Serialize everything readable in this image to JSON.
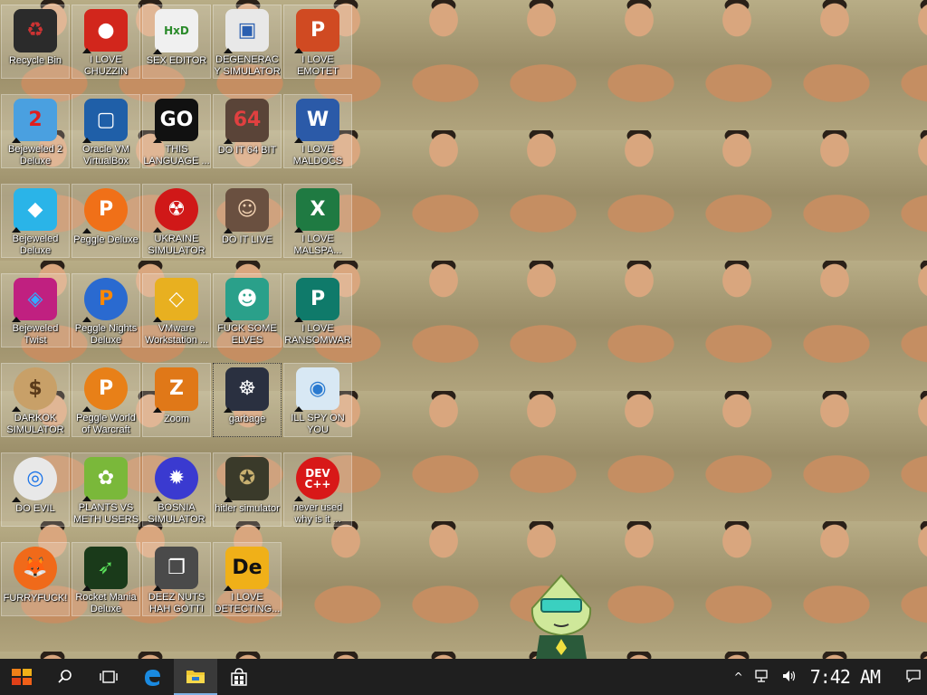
{
  "desktop": {
    "icons": [
      {
        "label": "Recycle Bin",
        "icon": "recycle-bin-icon",
        "bg": "#2b2b2b",
        "fg": "#c33",
        "ch": "♻",
        "shortcut": false
      },
      {
        "label": "I LOVE CHUZZIN",
        "icon": "chuzzle-icon",
        "bg": "#d2261c",
        "fg": "#fff",
        "ch": "●",
        "shortcut": true
      },
      {
        "label": "SEX EDITOR",
        "icon": "hxd-editor-icon",
        "bg": "#f0f0f0",
        "fg": "#2a8a2a",
        "ch": "HxD",
        "shortcut": true
      },
      {
        "label": "DEGENERACY SIMULATOR",
        "icon": "windows-sandbox-icon",
        "bg": "#e8e8e8",
        "fg": "#2a5fb0",
        "ch": "▣",
        "shortcut": true
      },
      {
        "label": "I LOVE EMOTET",
        "icon": "powerpoint-icon",
        "bg": "#d04a22",
        "fg": "#fff",
        "ch": "P",
        "shortcut": true
      },
      {
        "label": "Bejeweled 2 Deluxe",
        "icon": "bejeweled-2-icon",
        "bg": "#4aa0e0",
        "fg": "#e01e1e",
        "ch": "2",
        "shortcut": true
      },
      {
        "label": "Oracle VM VirtualBox",
        "icon": "virtualbox-icon",
        "bg": "#1f5fa8",
        "fg": "#fff",
        "ch": "▢",
        "shortcut": true
      },
      {
        "label": "THIS LANGUAGE ...",
        "icon": "goland-icon",
        "bg": "#111",
        "fg": "#fff",
        "ch": "GO",
        "shortcut": true
      },
      {
        "label": "DO IT 64 BIT",
        "icon": "portrait-64-icon",
        "bg": "#5a4438",
        "fg": "#e04040",
        "ch": "64",
        "shortcut": true
      },
      {
        "label": "I LOVE MALDOCS",
        "icon": "word-icon",
        "bg": "#2b5aa8",
        "fg": "#fff",
        "ch": "W",
        "shortcut": true
      },
      {
        "label": "Bejeweled Deluxe",
        "icon": "bejeweled-diamond-icon",
        "bg": "#2ab4e8",
        "fg": "#fff",
        "ch": "◆",
        "shortcut": true
      },
      {
        "label": "Peggle Deluxe",
        "icon": "peggle-icon",
        "bg": "#f07018",
        "fg": "#fff",
        "ch": "P",
        "shortcut": true
      },
      {
        "label": "UKRAINE SIMULATOR",
        "icon": "radiation-icon",
        "bg": "#d01818",
        "fg": "#fff",
        "ch": "☢",
        "shortcut": true
      },
      {
        "label": "DO IT LIVE",
        "icon": "portrait-icon",
        "bg": "#6a5040",
        "fg": "#f0d0b0",
        "ch": "☺",
        "shortcut": true
      },
      {
        "label": "I LOVE MALSPA...",
        "icon": "excel-icon",
        "bg": "#1f7a42",
        "fg": "#fff",
        "ch": "X",
        "shortcut": true
      },
      {
        "label": "Bejeweled Twist",
        "icon": "bejeweled-twist-icon",
        "bg": "#c02080",
        "fg": "#3af",
        "ch": "◈",
        "shortcut": true
      },
      {
        "label": "Peggle Nights Deluxe",
        "icon": "peggle-nights-icon",
        "bg": "#2a6ad0",
        "fg": "#f80",
        "ch": "P",
        "shortcut": true
      },
      {
        "label": "VMware Workstation ...",
        "icon": "vmware-icon",
        "bg": "#e8b020",
        "fg": "#fff",
        "ch": "◇",
        "shortcut": true
      },
      {
        "label": "FUCK SOME ELVES",
        "icon": "elf-icon",
        "bg": "#2aa08a",
        "fg": "#fff",
        "ch": "☻",
        "shortcut": true
      },
      {
        "label": "I LOVE RANSOMWARE",
        "icon": "publisher-icon",
        "bg": "#0f7a6a",
        "fg": "#fff",
        "ch": "P",
        "shortcut": true
      },
      {
        "label": "DARKOK SIMULATOR",
        "icon": "money-bag-icon",
        "bg": "#c8a068",
        "fg": "#5a3a1a",
        "ch": "$",
        "shortcut": true
      },
      {
        "label": "Peggle World of Warcraft Edition",
        "icon": "peggle-wow-icon",
        "bg": "#e88018",
        "fg": "#fff",
        "ch": "P",
        "shortcut": true
      },
      {
        "label": "Zoom",
        "icon": "zuma-icon",
        "bg": "#e07818",
        "fg": "#fff",
        "ch": "Z",
        "shortcut": true
      },
      {
        "label": "garbage",
        "icon": "elephant-emblem-icon",
        "bg": "#2a3040",
        "fg": "#fff",
        "ch": "☸",
        "shortcut": true,
        "selected": true
      },
      {
        "label": "ILL SPY ON YOU",
        "icon": "spy-camera-icon",
        "bg": "#d8e8f4",
        "fg": "#2a7ad0",
        "ch": "◉",
        "shortcut": true
      },
      {
        "label": "DO EVIL",
        "icon": "chrome-icon",
        "bg": "#e8e8e8",
        "fg": "#1a73e8",
        "ch": "◎",
        "shortcut": true
      },
      {
        "label": "PLANTS VS METH USERS",
        "icon": "plants-vs-zombies-icon",
        "bg": "#7ab83a",
        "fg": "#fff",
        "ch": "✿",
        "shortcut": true
      },
      {
        "label": "BOSNIA SIMULATOR",
        "icon": "virus-icon",
        "bg": "#3a3ad0",
        "fg": "#fff",
        "ch": "✹",
        "shortcut": true
      },
      {
        "label": "hitler simulator",
        "icon": "coin-emblem-icon",
        "bg": "#3a3a2a",
        "fg": "#c8b070",
        "ch": "✪",
        "shortcut": true
      },
      {
        "label": "never used why is it ...",
        "icon": "devcpp-icon",
        "bg": "#d81818",
        "fg": "#fff",
        "ch": "DEV\nC++",
        "shortcut": true
      },
      {
        "label": "FURRYFUCK!",
        "icon": "firefox-icon",
        "bg": "#f06a1a",
        "fg": "#fff",
        "ch": "🦊",
        "shortcut": false
      },
      {
        "label": "Rocket Mania Deluxe",
        "icon": "rocket-mania-icon",
        "bg": "#1a3a1a",
        "fg": "#5ae05a",
        "ch": "➶",
        "shortcut": true
      },
      {
        "label": "DEEZ NUTS HAH GOTTI",
        "icon": "stacked-windows-icon",
        "bg": "#4a4a4a",
        "fg": "#fff",
        "ch": "❐",
        "shortcut": true
      },
      {
        "label": "I LOVE DETECTING...",
        "icon": "detect-it-easy-icon",
        "bg": "#f0b018",
        "fg": "#111",
        "ch": "De",
        "shortcut": true
      }
    ]
  },
  "taskbar": {
    "start_icon": "start-icon",
    "search_icon": "search-icon",
    "taskview_icon": "task-view-icon",
    "edge_icon": "edge-icon",
    "explorer_icon": "file-explorer-icon",
    "store_icon": "store-icon",
    "tray": {
      "chevron": "^",
      "network": "network-icon",
      "volume": "volume-icon",
      "clock": "7:42 AM",
      "notifications": "notification-icon"
    }
  }
}
